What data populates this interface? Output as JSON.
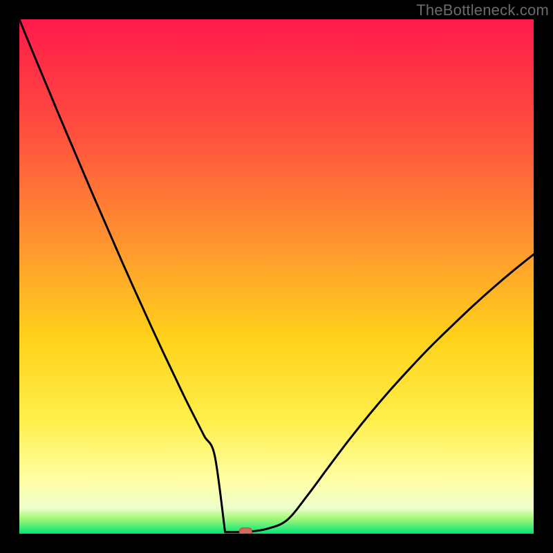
{
  "watermark": "TheBottleneck.com",
  "colors": {
    "frame": "#000000",
    "gradient_top": "#ff1a4b",
    "gradient_mid_upper": "#ff7a33",
    "gradient_mid": "#ffd21a",
    "gradient_lower": "#ffff99",
    "gradient_bottom": "#00e676",
    "curve": "#000000",
    "marker_fill": "#d46a5f",
    "marker_stroke": "#b94e44"
  },
  "chart_data": {
    "type": "line",
    "title": "",
    "xlabel": "",
    "ylabel": "",
    "xlim": [
      0,
      100
    ],
    "ylim": [
      0,
      100
    ],
    "x": [
      0,
      2,
      4,
      6,
      8,
      10,
      12,
      14,
      16,
      18,
      20,
      22,
      24,
      26,
      28,
      30,
      32,
      34,
      36,
      38,
      40,
      42,
      44,
      48,
      52,
      56,
      60,
      64,
      68,
      72,
      76,
      80,
      84,
      88,
      92,
      96,
      100
    ],
    "series": [
      {
        "name": "bottleneck-curve",
        "values": [
          100,
          95.1,
          90.3,
          85.5,
          80.7,
          76.0,
          71.3,
          66.6,
          62.0,
          57.4,
          52.8,
          48.3,
          43.9,
          39.5,
          35.2,
          31.0,
          26.8,
          22.8,
          18.9,
          15.1,
          11.6,
          8.3,
          5.4,
          0.9,
          2.6,
          7.4,
          12.8,
          18.1,
          23.1,
          27.8,
          32.2,
          36.4,
          40.3,
          44.1,
          47.7,
          51.1,
          54.3
        ]
      }
    ],
    "marker": {
      "x": 44,
      "y": 0.3
    },
    "flat_band": {
      "x_from": 40,
      "x_to": 44,
      "y": 0.3
    }
  }
}
